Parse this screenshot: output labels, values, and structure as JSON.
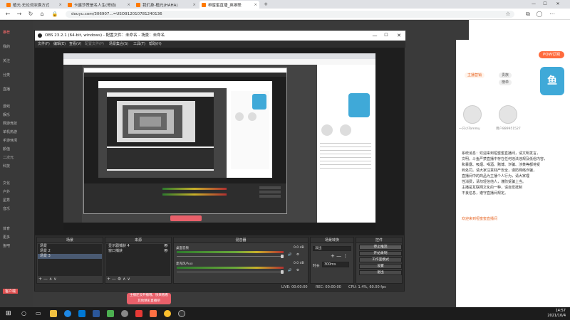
{
  "browser": {
    "tabs": [
      {
        "label": "植元·无论词浓换方式",
        "active": false,
        "color": "#ff7a00"
      },
      {
        "label": "卡露莎赞是名人生(哥动)",
        "active": false,
        "color": "#ff7a00"
      },
      {
        "label": "我们身-植元(HAHA)",
        "active": false,
        "color": "#ff7a00"
      },
      {
        "label": "桓蜜蜜直播_英雄联",
        "active": true,
        "color": "#ff7a00"
      }
    ],
    "new_tab": "+",
    "dropdown": "⌄",
    "url": "douyu.com/306907...=USO912010781240136",
    "window_controls": {
      "minimize": "—",
      "maximize": "☐",
      "close": "✕"
    }
  },
  "douyu": {
    "left_nav": [
      "推荐",
      "我的",
      "关注",
      "分类",
      "直播",
      "游戏",
      "娱乐",
      "网游竞技",
      "单机热游",
      "手游休闲",
      "颜值",
      "二次元",
      "科技",
      "文化",
      "户外",
      "星秀",
      "音乐",
      "体育",
      "更多",
      "鱼吧",
      "客户端"
    ],
    "right": {
      "follow_label": "POW订阅",
      "chip1": "主播营销",
      "chip2": "贵族",
      "chip3": "榜单",
      "mascot_text": "鱼",
      "chat_lines": [
        "系统消息：欢迎来到桓蜜蜜直播间，请文明发言，",
        "文明。斗鱼严禁直播中存在任何违法违规及低俗内容，",
        "和暴露、吸烟、喝酒、赌博、诈骗、涉黄等都将受",
        "到处罚。请大家注意财产安全，谨防网络诈骗，",
        "直播间中的商品为主播个人行为，请大家理",
        "性消费，请勿轻信他人，谨防受骗上当。",
        "主播是互联网文化的一种，请自觉抵制",
        "不良信息，遵守直播间规定。"
      ],
      "welcome_line": "欢迎来到桓蜜蜜直播间",
      "user1": "一只小Tommy",
      "user2": "用户889951527"
    }
  },
  "obs": {
    "title": "OBS 23.2.1 (64-bit, windows) - 配置文件：未命名 - 场景：未命名",
    "menu": [
      "文件(F)",
      "编辑(E)",
      "查看(V)",
      "配置文件(P)",
      "场景集合(S)",
      "工具(T)",
      "帮助(H)"
    ],
    "docks": {
      "scenes": {
        "title": "场景",
        "items": [
          "场景",
          "场景 2",
          "场景 3"
        ],
        "selected": 2
      },
      "sources": {
        "title": "来源",
        "items": [
          "显示器捕获 4",
          "窗口捕获"
        ]
      },
      "mixer": {
        "title": "混音器",
        "channels": [
          {
            "name": "桌面音频",
            "db": "0.0 dB",
            "level": 0.62
          },
          {
            "name": "麦克风/Aux",
            "db": "0.0 dB",
            "level": 0.55
          }
        ]
      },
      "transitions": {
        "title": "场景转换",
        "type": "淡出",
        "duration_label": "时长",
        "duration": "300ms"
      },
      "controls": {
        "title": "控件",
        "buttons": [
          "停止推流",
          "开始录制",
          "工作室模式",
          "设置",
          "退出"
        ]
      }
    },
    "status": {
      "live": "LIVE: 00:00:00",
      "rec": "REC: 00:00:00",
      "cpu": "CPU: 1.4%, 60.00 fps"
    },
    "foot_buttons": "+  —  ∧  ∨",
    "source_foot": "+  —  ⚙  ∧  ∨"
  },
  "red_bubble": {
    "line1": "主播还没开播哦，快来看看",
    "line2": "其他精彩直播吧"
  },
  "taskbar": {
    "time": "14:57",
    "date": "2021/10/4"
  }
}
